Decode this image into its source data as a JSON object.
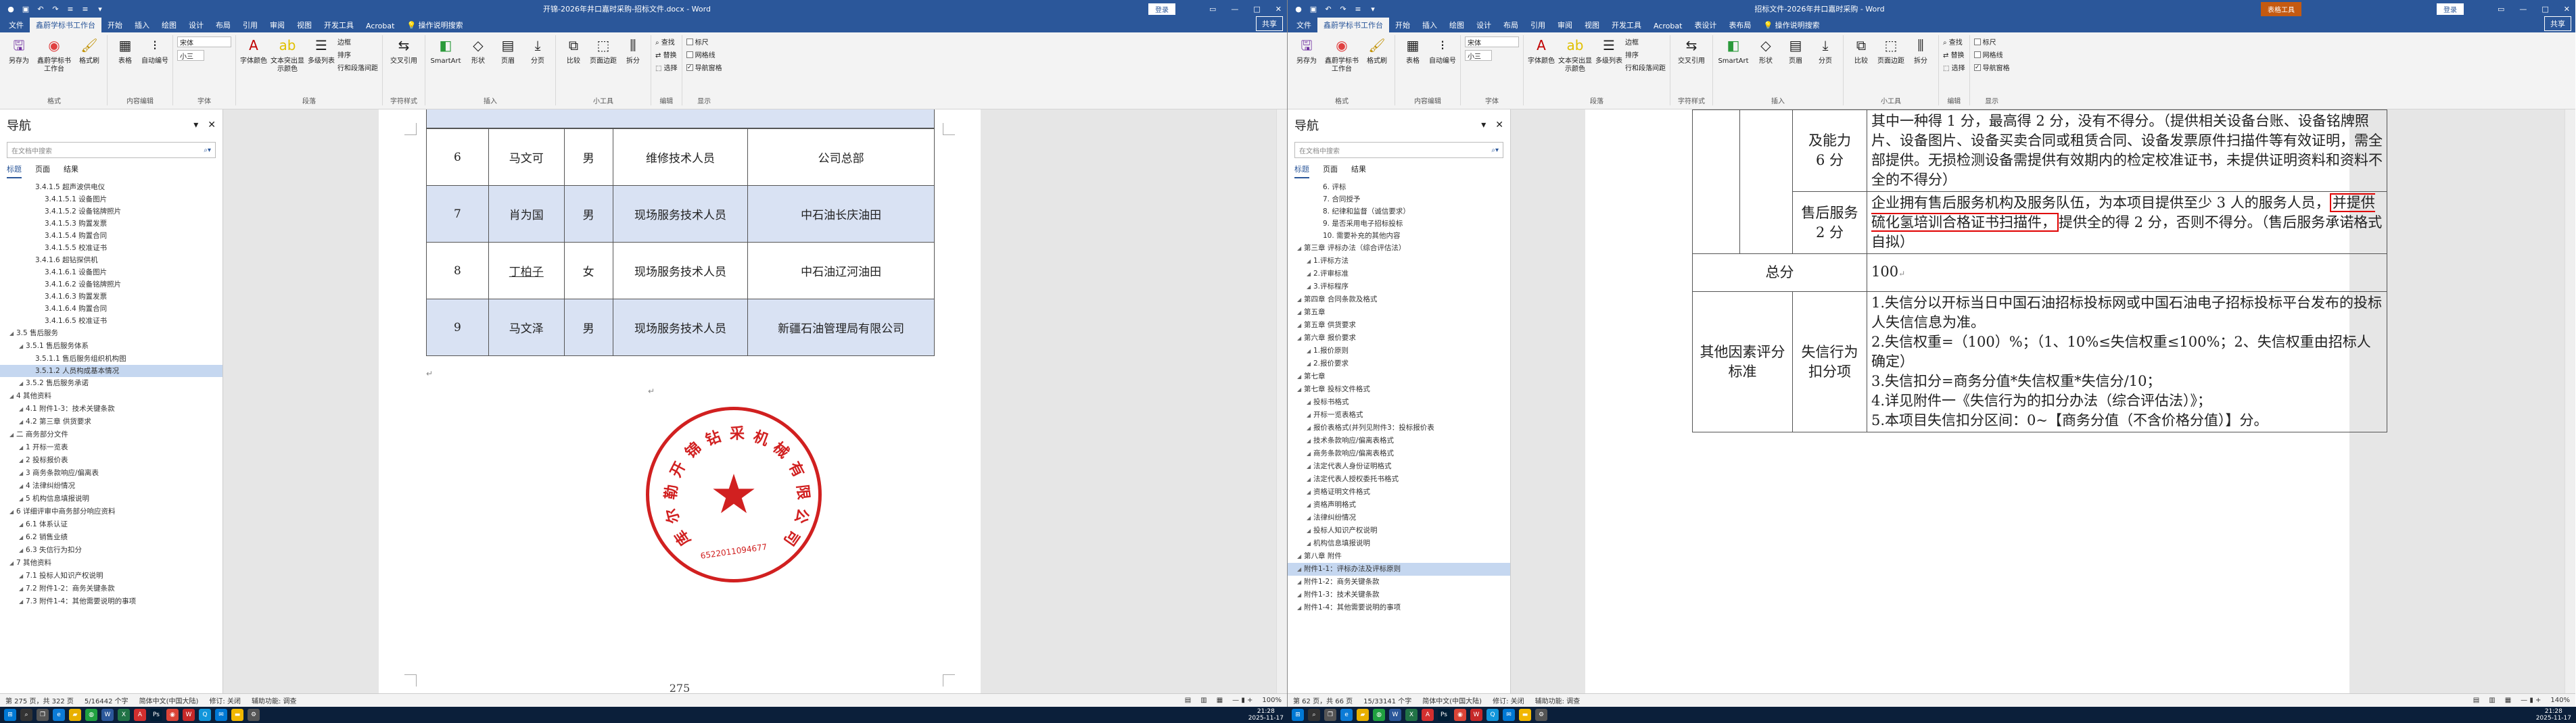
{
  "left": {
    "window_title": "开锦-2026年井口嘉时采购-招标文件.docx - Word",
    "login_label": "登录",
    "share_label": "共享",
    "tell_me": "操作说明搜索",
    "tabs": [
      "文件",
      "鑫蔚学标书工作台",
      "开始",
      "插入",
      "绘图",
      "设计",
      "布局",
      "引用",
      "审阅",
      "视图",
      "开发工具",
      "Acrobat"
    ],
    "ribbon": {
      "save_label": "另存为",
      "tool_label": "鑫蔚学标书工作台",
      "tool_sub": "鑫蔚学标书工作台",
      "painter_label": "格式刷",
      "layout_group": "格式",
      "table_label": "表格",
      "autonum_label": "自动编号",
      "content_group": "内容编辑",
      "font_value": "宋体",
      "size_value": "小三",
      "font_group": "字体",
      "fontcolor_label": "字体颜色",
      "shading_label": "文本突出显示颜色",
      "multilevel_label": "多级列表",
      "para_group": "段落",
      "border_label": "边框",
      "sort_label": "排序",
      "linespacing_label": "行和段落间距",
      "textstyle_group": "字符样式",
      "crossref_label": "交叉引用",
      "smartart_label": "SmartArt",
      "shape_label": "形状",
      "pagebreak_label": "分页",
      "page_label": "页眉",
      "compare_label": "比较",
      "pagenum_label": "页面边距",
      "split_label": "拆分",
      "tools_group": "小工具",
      "find_label": "查找",
      "replace_label": "替换",
      "select_label": "选择",
      "edit_group": "编辑",
      "ruler_label": "标尺",
      "grid_label": "网格线",
      "navpane_label": "导航窗格",
      "show_group": "显示",
      "insert_group": "插入"
    },
    "nav": {
      "title": "导航",
      "search_placeholder": "在文档中搜索",
      "tabs": [
        "标题",
        "页面",
        "结果"
      ],
      "items": [
        {
          "d": 2,
          "t": "3.4.1.5 超声波供电仪"
        },
        {
          "d": 3,
          "t": "3.4.1.5.1 设备图片"
        },
        {
          "d": 3,
          "t": "3.4.1.5.2 设备铭牌照片"
        },
        {
          "d": 3,
          "t": "3.4.1.5.3 购置发票"
        },
        {
          "d": 3,
          "t": "3.4.1.5.4 购置合同"
        },
        {
          "d": 3,
          "t": "3.4.1.5.5 校准证书"
        },
        {
          "d": 2,
          "t": "3.4.1.6 超钻探供机"
        },
        {
          "d": 3,
          "t": "3.4.1.6.1 设备图片"
        },
        {
          "d": 3,
          "t": "3.4.1.6.2 设备铭牌照片"
        },
        {
          "d": 3,
          "t": "3.4.1.6.3 购置发票"
        },
        {
          "d": 3,
          "t": "3.4.1.6.4 购置合同"
        },
        {
          "d": 3,
          "t": "3.4.1.6.5 校准证书"
        },
        {
          "d": 0,
          "t": "3.5 售后服务"
        },
        {
          "d": 1,
          "t": "3.5.1 售后服务体系"
        },
        {
          "d": 2,
          "t": "3.5.1.1 售后服务组织机构图"
        },
        {
          "d": 2,
          "t": "3.5.1.2 人员构成基本情况",
          "sel": true
        },
        {
          "d": 1,
          "t": "3.5.2 售后服务承诺"
        },
        {
          "d": 0,
          "t": "4 其他资料"
        },
        {
          "d": 1,
          "t": "4.1 附件1-3：技术关键条款"
        },
        {
          "d": 1,
          "t": "4.2 第三章 供货要求"
        },
        {
          "d": 0,
          "t": "二 商务部分文件"
        },
        {
          "d": 1,
          "t": "1 开标一览表"
        },
        {
          "d": 1,
          "t": "2 投标报价表"
        },
        {
          "d": 1,
          "t": "3 商务条款响应/偏离表"
        },
        {
          "d": 1,
          "t": "4 法律纠纷情况"
        },
        {
          "d": 1,
          "t": "5 机构信息填报说明"
        },
        {
          "d": 0,
          "t": "6 详细评审中商务部分响应资料"
        },
        {
          "d": 1,
          "t": "6.1 体系认证"
        },
        {
          "d": 1,
          "t": "6.2 销售业绩"
        },
        {
          "d": 1,
          "t": "6.3 失信行为扣分"
        },
        {
          "d": 0,
          "t": "7 其他资料"
        },
        {
          "d": 1,
          "t": "7.1 投标人知识产权说明"
        },
        {
          "d": 1,
          "t": "7.2 附件1-2：商务关键条款"
        },
        {
          "d": 1,
          "t": "7.3 附件1-4：其他需要说明的事项"
        }
      ]
    },
    "table": [
      {
        "no": "6",
        "name": "马文可",
        "sex": "男",
        "role": "维修技术人员",
        "org": "公司总部"
      },
      {
        "no": "7",
        "name": "肖为国",
        "sex": "男",
        "role": "现场服务技术人员",
        "org": "中石油长庆油田"
      },
      {
        "no": "8",
        "name": "丁柏子",
        "sex": "女",
        "role": "现场服务技术人员",
        "org": "中石油辽河油田"
      },
      {
        "no": "9",
        "name": "马文泽",
        "sex": "男",
        "role": "现场服务技术人员",
        "org": "新疆石油管理局有限公司"
      }
    ],
    "seal_text": "库尔勒开锦钻采机械有限公司",
    "seal_number": "6522011094677",
    "page_number": "275",
    "status": {
      "page": "第 275 页，共 322 页",
      "words": "5/16442 个字",
      "lang": "简体中文(中国大陆)",
      "track": "修订: 关闭",
      "access": "辅助功能: 调查",
      "zoom": "100%"
    }
  },
  "right": {
    "window_title": "招标文件-2026年井口嘉时采购 - Word",
    "ctx_tab": "表格工具",
    "login_label": "登录",
    "share_label": "共享",
    "tell_me": "操作说明搜索",
    "tabs": [
      "文件",
      "鑫蔚学标书工作台",
      "开始",
      "插入",
      "绘图",
      "设计",
      "布局",
      "引用",
      "审阅",
      "视图",
      "开发工具",
      "Acrobat",
      "表设计",
      "表布局"
    ],
    "nav": {
      "title": "导航",
      "search_placeholder": "在文档中搜索",
      "tabs": [
        "标题",
        "页面",
        "结果"
      ],
      "items": [
        {
          "d": 2,
          "t": "6. 评标"
        },
        {
          "d": 2,
          "t": "7. 合同授予"
        },
        {
          "d": 2,
          "t": "8. 纪律和监督（诚信要求）"
        },
        {
          "d": 2,
          "t": "9. 是否采用电子招标投标"
        },
        {
          "d": 2,
          "t": "10. 需要补充的其他内容"
        },
        {
          "d": 0,
          "t": "第三章 评标办法（综合评估法）"
        },
        {
          "d": 1,
          "t": "1.评标方法"
        },
        {
          "d": 1,
          "t": "2.评审标准"
        },
        {
          "d": 1,
          "t": "3.评标程序"
        },
        {
          "d": 0,
          "t": "第四章 合同条款及格式"
        },
        {
          "d": 0,
          "t": "第五章"
        },
        {
          "d": 0,
          "t": "第五章 供货要求"
        },
        {
          "d": 0,
          "t": "第六章 报价要求"
        },
        {
          "d": 1,
          "t": "1.报价原则"
        },
        {
          "d": 1,
          "t": "2.报价要求"
        },
        {
          "d": 0,
          "t": "第七章"
        },
        {
          "d": 0,
          "t": "第七章 投标文件格式"
        },
        {
          "d": 1,
          "t": "投标书格式"
        },
        {
          "d": 1,
          "t": "开标一览表格式"
        },
        {
          "d": 1,
          "t": "报价表格式(并列见附件3：投标报价表"
        },
        {
          "d": 1,
          "t": "技术条款响应/偏离表格式"
        },
        {
          "d": 1,
          "t": "商务条款响应/偏离表格式"
        },
        {
          "d": 1,
          "t": "法定代表人身份证明格式"
        },
        {
          "d": 1,
          "t": "法定代表人授权委托书格式"
        },
        {
          "d": 1,
          "t": "资格证明文件格式"
        },
        {
          "d": 1,
          "t": "资格声明格式"
        },
        {
          "d": 1,
          "t": "法律纠纷情况"
        },
        {
          "d": 1,
          "t": "投标人知识产权说明"
        },
        {
          "d": 1,
          "t": "机构信息填报说明"
        },
        {
          "d": 0,
          "t": "第八章 附件"
        },
        {
          "d": 0,
          "t": "附件1-1：评标办法及评标原则",
          "sel": true
        },
        {
          "d": 0,
          "t": "附件1-2：商务关键条款"
        },
        {
          "d": 0,
          "t": "附件1-3：技术关键条款"
        },
        {
          "d": 0,
          "t": "附件1-4：其他需要说明的事项"
        }
      ]
    },
    "score_table": {
      "r1_label": "及能力\n6 分",
      "r1_text": "其中一种得 1 分，最高得 2 分，没有不得分。（提供相关设备台账、设备铭牌照片、设备图片、设备买卖合同或租赁合同、设备发票原件扫描件等有效证明，需全部提供。无损检测设备需提供有效期内的检定校准证书，未提供证明资料和资料不全的不得分）",
      "r2_label": "售后服务\n2 分",
      "r2_pre": "企业拥有售后服务机构及服务队伍，为本项目提供至少 3 人的服务人员，",
      "r2_hl": "并提供硫化氢培训合格证书扫描件，",
      "r2_post": "提供全的得 2 分，否则不得分。（售后服务承诺格式自拟）",
      "total_label": "总分",
      "total_value": "100",
      "other_label": "其他因素评分标准",
      "credit_label": "失信行为\n扣分项",
      "credit_items": [
        "1.失信分以开标当日中国石油招标投标网或中国石油电子招标投标平台发布的投标人失信信息为准。",
        "2.失信权重=（100）%；（1、10%≤失信权重≤100%；2、失信权重由招标人确定）",
        "3.失信扣分=商务分值*失信权重*失信分/10；",
        "4.详见附件一《失信行为的扣分办法（综合评估法）》；",
        "5.本项目失信扣分区间：0~【商务分值（不含价格分值）】分。"
      ]
    },
    "status": {
      "page": "第 62 页，共 66 页",
      "words": "15/33141 个字",
      "lang": "简体中文(中国大陆)",
      "track": "修订: 关闭",
      "access": "辅助功能: 调查",
      "zoom": "140%"
    }
  },
  "taskbar": {
    "left_time": "21:28",
    "left_date": "2025-11-17",
    "right_time": "21:28",
    "right_date": "2025-11-17"
  }
}
